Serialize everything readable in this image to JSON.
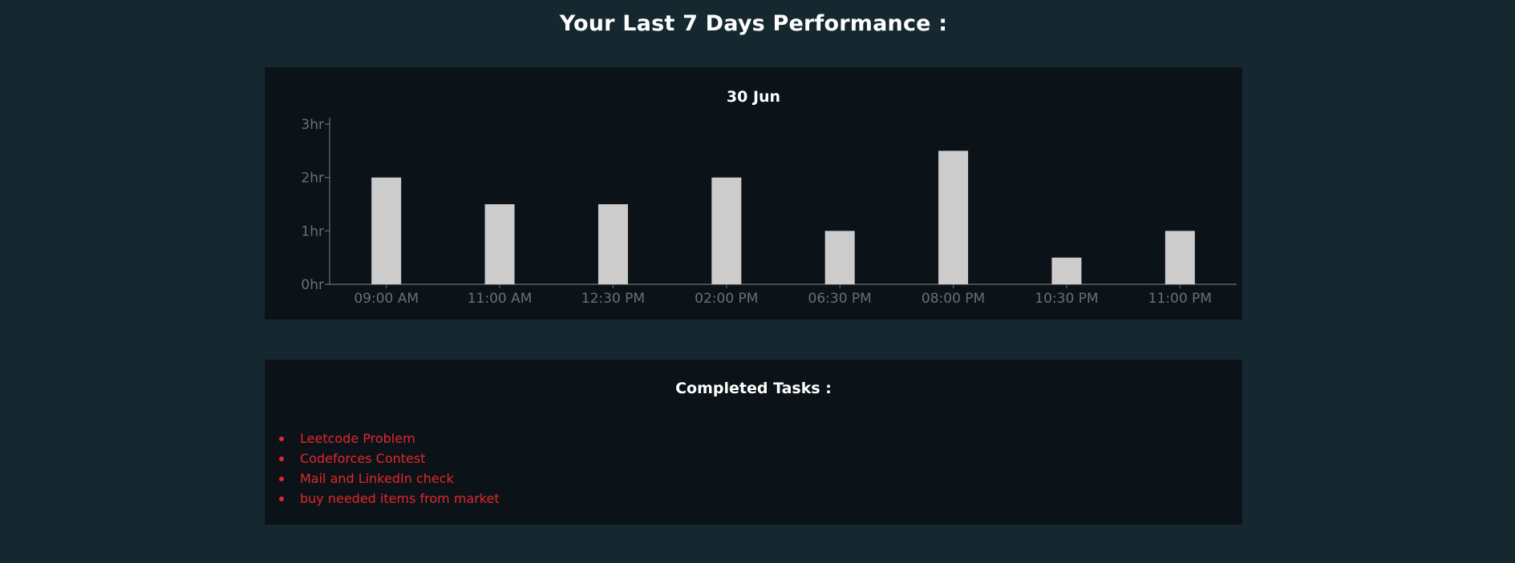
{
  "page": {
    "heading": "Your Last 7 Days Performance :"
  },
  "chart_data": {
    "type": "bar",
    "title": "30 Jun",
    "xlabel": "",
    "ylabel": "",
    "categories": [
      "09:00 AM",
      "11:00 AM",
      "12:30 PM",
      "02:00 PM",
      "06:30 PM",
      "08:00 PM",
      "10:30 PM",
      "11:00 PM"
    ],
    "values": [
      2,
      1.5,
      1.5,
      2,
      1,
      2.5,
      0.5,
      1
    ],
    "ylim": [
      0,
      3
    ],
    "yticks": [
      0,
      1,
      2,
      3
    ],
    "ytick_labels": [
      "0hr",
      "1hr",
      "2hr",
      "3hr"
    ],
    "grid": false,
    "legend": "none",
    "bar_color": "#cccccc",
    "axis_color": "#6e6e6e"
  },
  "tasks": {
    "title": "Completed Tasks :",
    "items": [
      "Leetcode Problem",
      "Codeforces Contest",
      "Mail and LinkedIn check",
      "buy needed items from market"
    ],
    "item_color": "#e3262b"
  }
}
